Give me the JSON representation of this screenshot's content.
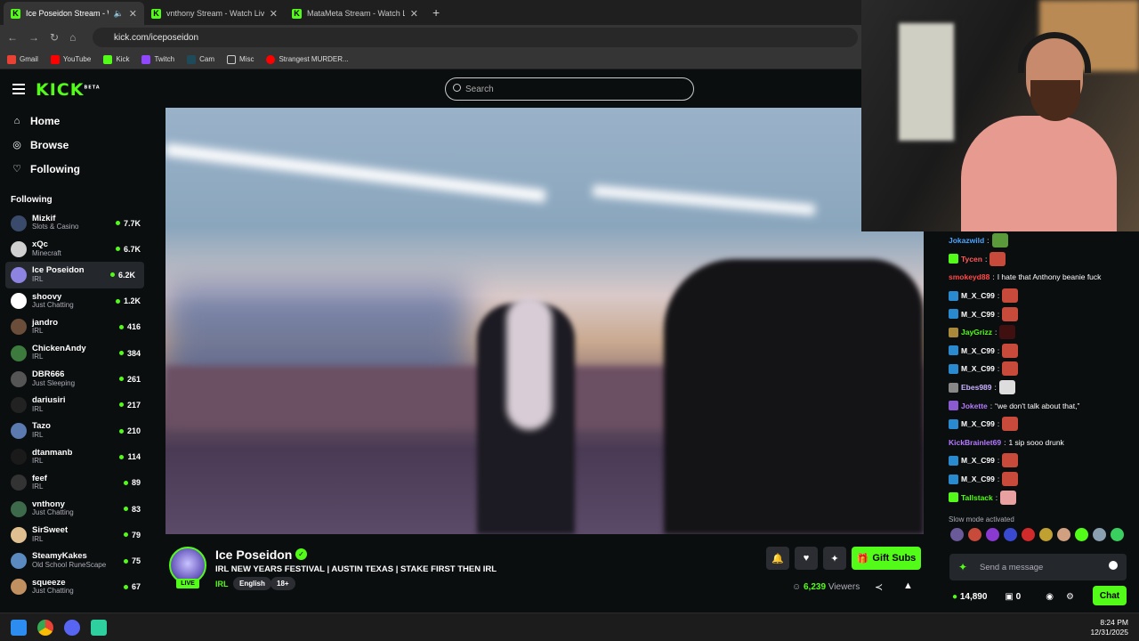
{
  "browser": {
    "tabs": [
      {
        "title": "Ice Poseidon Stream - Watch Live on Kick",
        "active": true
      },
      {
        "title": "vnthony Stream - Watch Live on Kick",
        "active": false
      },
      {
        "title": "MataMeta Stream - Watch Live on Kick",
        "active": false
      }
    ],
    "url": "kick.com/iceposeidon",
    "bookmarks": [
      "Gmail",
      "YouTube",
      "Kick",
      "Twitch",
      "Cam",
      "Misc",
      "Strangest MURDER..."
    ]
  },
  "header": {
    "logo": "KICK",
    "logo_badge": "BETA",
    "search_placeholder": "Search"
  },
  "sidebar": {
    "nav": [
      {
        "label": "Home",
        "icon": "home-icon"
      },
      {
        "label": "Browse",
        "icon": "compass-icon"
      },
      {
        "label": "Following",
        "icon": "heart-icon"
      }
    ],
    "following_heading": "Following",
    "channels": [
      {
        "name": "Mizkif",
        "category": "Slots & Casino",
        "viewers": "7.7K",
        "color": "#3a4a6a"
      },
      {
        "name": "xQc",
        "category": "Minecraft",
        "viewers": "6.7K",
        "color": "#d0d0d0"
      },
      {
        "name": "Ice Poseidon",
        "category": "IRL",
        "viewers": "6.2K",
        "color": "#8c84e0"
      },
      {
        "name": "shoovy",
        "category": "Just Chatting",
        "viewers": "1.2K",
        "color": "#ffffff"
      },
      {
        "name": "jandro",
        "category": "IRL",
        "viewers": "416",
        "color": "#6a4e3a"
      },
      {
        "name": "ChickenAndy",
        "category": "IRL",
        "viewers": "384",
        "color": "#3d7a3d"
      },
      {
        "name": "DBR666",
        "category": "Just Sleeping",
        "viewers": "261",
        "color": "#555555"
      },
      {
        "name": "dariusiri",
        "category": "IRL",
        "viewers": "217",
        "color": "#222222"
      },
      {
        "name": "Tazo",
        "category": "IRL",
        "viewers": "210",
        "color": "#5a7ab0"
      },
      {
        "name": "dtanmanb",
        "category": "IRL",
        "viewers": "114",
        "color": "#1a1a1a"
      },
      {
        "name": "feef",
        "category": "IRL",
        "viewers": "89",
        "color": "#333333"
      },
      {
        "name": "vnthony",
        "category": "Just Chatting",
        "viewers": "83",
        "color": "#3c6a4a"
      },
      {
        "name": "SirSweet",
        "category": "IRL",
        "viewers": "79",
        "color": "#e0c090"
      },
      {
        "name": "SteamyKakes",
        "category": "Old School RuneScape",
        "viewers": "75",
        "color": "#5a8ac0"
      },
      {
        "name": "squeeze",
        "category": "Just Chatting",
        "viewers": "67",
        "color": "#c09060"
      }
    ]
  },
  "stream": {
    "channel_name": "Ice Poseidon",
    "live_label": "LIVE",
    "title": "IRL NEW YEARS FESTIVAL | AUSTIN TEXAS | STAKE FIRST THEN IRL",
    "category": "IRL",
    "tags": [
      "English",
      "18+"
    ],
    "gift_label": "Gift Subs",
    "viewer_count": "6,239",
    "viewers_label": "Viewers"
  },
  "chat": {
    "messages": [
      {
        "user": "Jokazwild",
        "color": "#4aa3ff",
        "text": "",
        "emote": "#5a9a3a",
        "badge": ""
      },
      {
        "user": "Tycen",
        "color": "#ff5a5a",
        "text": "",
        "emote": "#c84a3a",
        "badge": "#53fc18"
      },
      {
        "user": "smokeyd88",
        "color": "#ff4a4a",
        "text": "I hate that Anthony beanie fuck",
        "emote": "",
        "badge": ""
      },
      {
        "user": "M_X_C99",
        "color": "#ffffff",
        "text": "",
        "emote": "#c84a3a",
        "badge": "#2a8ad0"
      },
      {
        "user": "M_X_C99",
        "color": "#ffffff",
        "text": "",
        "emote": "#c84a3a",
        "badge": "#2a8ad0"
      },
      {
        "user": "JayGrizz",
        "color": "#53fc18",
        "text": "",
        "emote": "#401010",
        "badge": "#aa8a3a"
      },
      {
        "user": "M_X_C99",
        "color": "#ffffff",
        "text": "",
        "emote": "#c84a3a",
        "badge": "#2a8ad0"
      },
      {
        "user": "M_X_C99",
        "color": "#ffffff",
        "text": "",
        "emote": "#c84a3a",
        "badge": "#2a8ad0"
      },
      {
        "user": "Ebes989",
        "color": "#c9b3ff",
        "text": "",
        "emote": "#dddddd",
        "badge": "#888888"
      },
      {
        "user": "Jokette",
        "color": "#b57bff",
        "text": "“we don't talk about that,”",
        "emote": "",
        "badge": "#8a5ad0"
      },
      {
        "user": "M_X_C99",
        "color": "#ffffff",
        "text": "",
        "emote": "#c84a3a",
        "badge": "#2a8ad0"
      },
      {
        "user": "KickBrainlet69",
        "color": "#b57bff",
        "text": "1 sip sooo drunk",
        "emote": "",
        "badge": ""
      },
      {
        "user": "M_X_C99",
        "color": "#ffffff",
        "text": "",
        "emote": "#c84a3a",
        "badge": "#2a8ad0"
      },
      {
        "user": "M_X_C99",
        "color": "#ffffff",
        "text": "",
        "emote": "#c84a3a",
        "badge": "#2a8ad0"
      },
      {
        "user": "Tallstack",
        "color": "#53fc18",
        "text": "",
        "emote": "#e8a0a0",
        "badge": "#53fc18"
      }
    ],
    "slow_mode": "Slow mode activated",
    "input_placeholder": "Send a message",
    "points": "14,890",
    "gifts": "0",
    "chat_button": "Chat"
  },
  "taskbar": {
    "time": "8:24 PM",
    "date": "12/31/2025"
  },
  "colors": {
    "brand": "#53fc18",
    "background": "#0b0e0f",
    "panel": "#24272c"
  }
}
